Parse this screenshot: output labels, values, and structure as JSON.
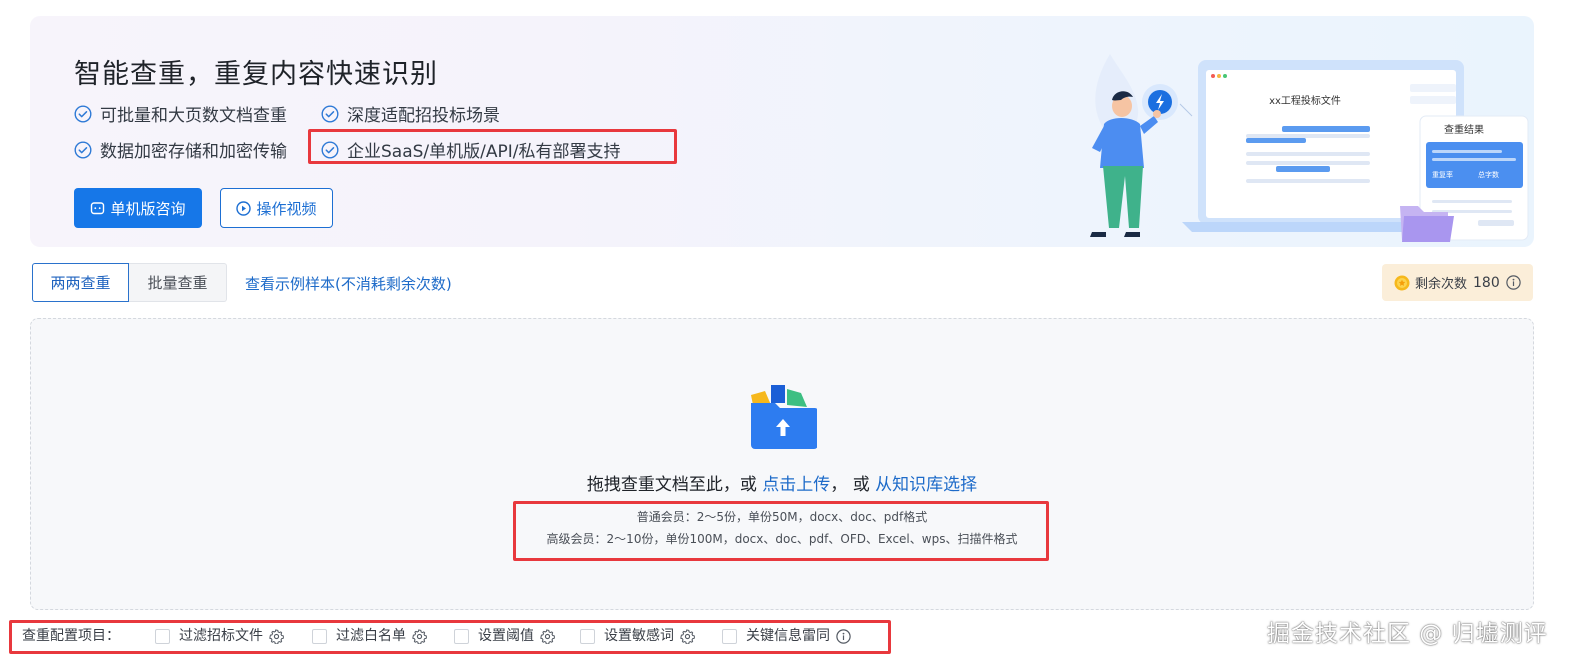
{
  "hero": {
    "title": "智能查重，重复内容快速识别",
    "features": [
      "可批量和大页数文档查重",
      "深度适配招投标场景",
      "数据加密存储和加密传输",
      "企业SaaS/单机版/API/私有部署支持"
    ],
    "buttons": {
      "consult": "单机版咨询",
      "video": "操作视频"
    },
    "illustration": {
      "doc_title": "xx工程投标文件",
      "result_title": "查重结果",
      "rate_label": "重复率",
      "word_label": "总字数"
    }
  },
  "tabs": {
    "pairwise": "两两查重",
    "batch": "批量查重",
    "sample_link": "查看示例样本(不消耗剩余次数)"
  },
  "quota": {
    "label": "剩余次数",
    "value": "180"
  },
  "upload": {
    "drag_text": "拖拽查重文档至此，或 ",
    "click_upload": "点击上传",
    "or_text": "， 或 ",
    "from_kb": "从知识库选择",
    "normal_member": "普通会员：2～5份，单份50M，docx、doc、pdf格式",
    "advanced_member": "高级会员：2～10份，单份100M，docx、doc、pdf、OFD、Excel、wps、扫描件格式"
  },
  "config": {
    "label": "查重配置项目：",
    "options": [
      "过滤招标文件",
      "过滤白名单",
      "设置阈值",
      "设置敏感词",
      "关键信息雷同"
    ]
  },
  "watermark": "掘金技术社区 @ 归墟测评",
  "colors": {
    "primary": "#1677e8",
    "link": "#1e6bc9",
    "highlight": "#e8383d",
    "quota_bg": "#fbeed9"
  }
}
